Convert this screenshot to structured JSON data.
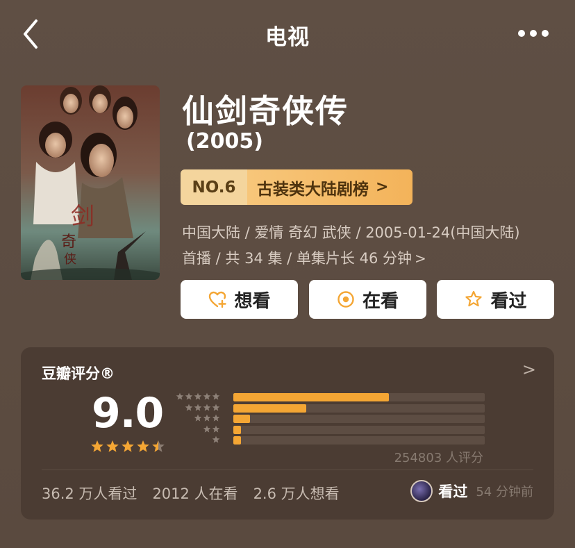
{
  "nav": {
    "title": "电视",
    "back_icon": "chevron-left-icon",
    "more_icon": "more-dots-icon"
  },
  "show": {
    "title": "仙剑奇侠传",
    "year": "(2005)",
    "rank_no": "NO.6",
    "rank_name": "古装类大陆剧榜",
    "rank_chevron": ">",
    "meta_line1": "中国大陆 / 爱情 奇幻 武侠 / 2005-01-24(中国大陆)",
    "meta_line2": "首播 / 共 34 集 / 单集片长 46 分钟",
    "meta_chevron": ">"
  },
  "actions": {
    "want": "想看",
    "watching": "在看",
    "watched": "看过"
  },
  "rating": {
    "label": "豆瓣评分®",
    "chevron": ">",
    "score": "9.0",
    "stars_value": 4.5,
    "distribution": [
      {
        "stars": 5,
        "fraction": 0.62
      },
      {
        "stars": 4,
        "fraction": 0.29
      },
      {
        "stars": 3,
        "fraction": 0.065
      },
      {
        "stars": 2,
        "fraction": 0.03
      },
      {
        "stars": 1,
        "fraction": 0.03
      }
    ],
    "total": "254803 人评分"
  },
  "stats": {
    "watched": "36.2 万人看过",
    "watching": "2012 人在看",
    "want": "2.6 万人想看"
  },
  "friend": {
    "status": "看过",
    "time": "54 分钟前"
  },
  "colors": {
    "background": "#5e4e43",
    "card": "#4b3c33",
    "accent": "#f4a634",
    "rank_badge": "#f4d59d"
  }
}
